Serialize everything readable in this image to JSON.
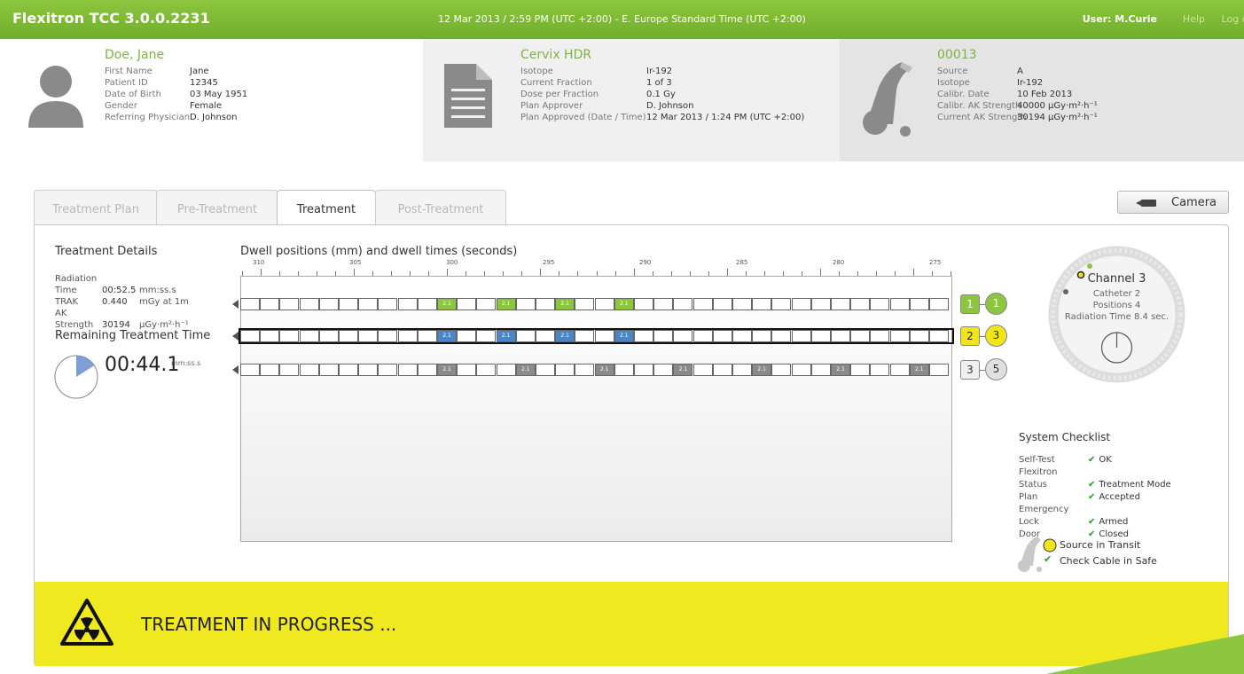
{
  "titlebar": {
    "app_title": "Flexitron TCC 3.0.0.2231",
    "datetime": "12 Mar 2013 / 2:59 PM (UTC +2:00) - E. Europe Standard Time (UTC +2:00)",
    "user": "User: M.Curie",
    "help": "Help",
    "logoff": "Log off"
  },
  "patient": {
    "name": "Doe, Jane",
    "fields": [
      {
        "k": "First Name",
        "v": "Jane"
      },
      {
        "k": "Patient ID",
        "v": "12345"
      },
      {
        "k": "Date of Birth",
        "v": "03 May 1951"
      },
      {
        "k": "Gender",
        "v": "Female"
      },
      {
        "k": "Referring Physician",
        "v": "D. Johnson"
      }
    ]
  },
  "plan": {
    "name": "Cervix HDR",
    "fields": [
      {
        "k": "Isotope",
        "v": "Ir-192"
      },
      {
        "k": "Current Fraction",
        "v": "1  of  3"
      },
      {
        "k": "Dose per Fraction",
        "v": "0.1 Gy"
      },
      {
        "k": "Plan Approver",
        "v": "D. Johnson"
      },
      {
        "k": "Plan Approved (Date / Time)",
        "v": "12 Mar 2013 / 1:24 PM (UTC +2:00)"
      }
    ]
  },
  "source": {
    "id": "00013",
    "fields": [
      {
        "k": "Source",
        "v": "A"
      },
      {
        "k": "Isotope",
        "v": "Ir-192"
      },
      {
        "k": "Calibr. Date",
        "v": "10 Feb 2013"
      },
      {
        "k": "Calibr. AK Strength",
        "v": "40000 µGy·m²·h⁻¹"
      },
      {
        "k": "Current AK Strength",
        "v": "30194 µGy·m²·h⁻¹"
      }
    ]
  },
  "tabs": [
    {
      "label": "Treatment Plan",
      "active": false
    },
    {
      "label": "Pre-Treatment",
      "active": false
    },
    {
      "label": "Treatment",
      "active": true
    },
    {
      "label": "Post-Treatment",
      "active": false
    }
  ],
  "camera_label": "Camera",
  "treatment_details": {
    "title": "Treatment Details",
    "rows": [
      {
        "k": "Radiation Time",
        "v": "00:52.5",
        "u": "mm:ss.s"
      },
      {
        "k": "TRAK",
        "v": "0.440",
        "u": "mGy at 1m"
      },
      {
        "k": "AK Strength",
        "v": "30194",
        "u": "µGy·m²·h⁻¹"
      }
    ]
  },
  "remaining": {
    "title": "Remaining Treatment Time",
    "time": "00:44.1",
    "unit": "mm:ss.s",
    "elapsed_fraction": 0.16
  },
  "dwell": {
    "title": "Dwell positions (mm) and dwell times (seconds)",
    "ticks": [
      "310",
      "305",
      "300",
      "295",
      "290",
      "285",
      "280",
      "275"
    ],
    "channels": [
      {
        "badge": "1",
        "circle": "1",
        "color": "#8cc63f",
        "dwell_label": "2.1",
        "dwell_slots": [
          10,
          13,
          16,
          19
        ]
      },
      {
        "badge": "2",
        "circle": "3",
        "color": "#4a86c8",
        "dwell_label": "2.1",
        "dwell_slots": [
          10,
          13,
          16,
          19
        ]
      },
      {
        "badge": "3",
        "circle": "5",
        "color": "#8a8a8a",
        "dwell_label": "2.1",
        "dwell_slots": [
          10,
          14,
          18,
          22,
          26,
          30,
          34
        ]
      }
    ]
  },
  "catheter": {
    "channel": "Channel 3",
    "catheter": "Catheter 2",
    "positions": "Positions 4",
    "radiation_time": "Radiation Time 8.4 sec."
  },
  "checklist": {
    "title": "System Checklist",
    "items": [
      {
        "k": "Self-Test",
        "v": "OK"
      },
      {
        "k": "Flexitron Status",
        "v": "Treatment Mode"
      },
      {
        "k": "Plan",
        "v": "Accepted"
      },
      {
        "k": "Emergency Lock",
        "v": "Armed"
      },
      {
        "k": "Door",
        "v": "Closed"
      }
    ]
  },
  "status": {
    "source_transit": "Source in Transit",
    "check_cable": "Check Cable in Safe"
  },
  "banner": {
    "message": "TREATMENT IN PROGRESS ..."
  },
  "colors": {
    "brand_green": "#7cb342",
    "banner_yellow": "#f1e91f",
    "channel_green": "#8cc63f",
    "channel_blue": "#4a86c8",
    "channel_yellow": "#f2e41b"
  }
}
